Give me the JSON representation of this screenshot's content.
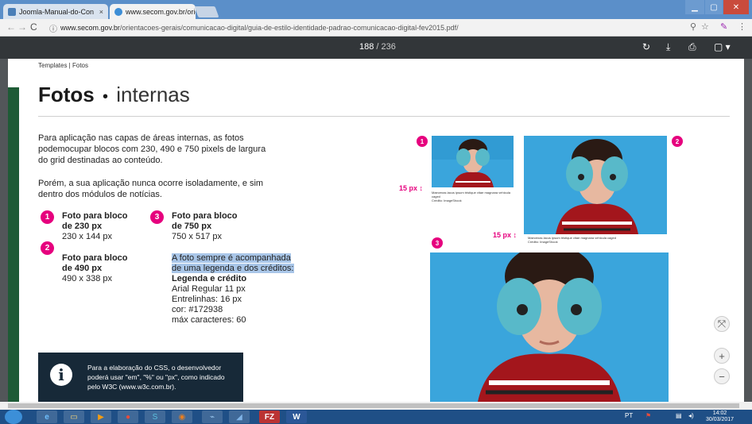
{
  "browser": {
    "tabs": [
      {
        "title": "Joomla-Manual-do-Con",
        "active": false
      },
      {
        "title": "www.secom.gov.br/orien",
        "active": true
      }
    ],
    "close_glyph": "×",
    "url_host": "www.secom.gov.br",
    "url_path": "/orientacoes-gerais/comunicacao-digital/guia-de-estilo-identidade-padrao-comunicacao-digital-fev2015.pdf/",
    "window_controls": [
      "minimize-icon",
      "maximize-icon",
      "close-icon"
    ]
  },
  "pdf_toolbar": {
    "page_current": "188",
    "page_total": "/ 236",
    "icons": [
      "rotate-icon",
      "download-icon",
      "print-icon",
      "bookmark-icon"
    ]
  },
  "document": {
    "breadcrumb": "Templates | Fotos",
    "heading_bold": "Fotos",
    "heading_sep": "•",
    "heading_light": "internas",
    "para1": "Para aplicação nas capas de áreas internas, as fotos podemocupar blocos com 230, 490 e 750 pixels de largura do grid destinadas ao conteúdo.",
    "para2": "Porém, a sua aplicação nunca ocorre isoladamente, e sim dentro dos módulos de notícias.",
    "specs": [
      {
        "num": "1",
        "title_line1": "Foto para bloco",
        "title_line2": "de 230 px",
        "size": "230 x 144 px"
      },
      {
        "num": "2",
        "title_line1": "Foto para bloco",
        "title_line2": "de 490 px",
        "size": "490 x 338 px"
      },
      {
        "num": "3",
        "title_line1": "Foto para bloco",
        "title_line2": "de 750 px",
        "size": "750 x 517 px"
      }
    ],
    "caption_note": {
      "line1": "A foto sempre é  acompanhada",
      "line2": "de uma legenda e dos créditos:",
      "title": "Legenda e crédito",
      "font": "Arial Regular 11 px",
      "leading": "Entrelinhas: 16 px",
      "color": "cor: #172938",
      "max": "máx caracteres: 60"
    },
    "info_box": {
      "icon": "info-icon",
      "glyph": "i",
      "text": "Para a elaboração do CSS, o desenvolvedor poderá usar \"em\", \"%\" ou \"px\", como indicado pelo W3C (www.w3c.com.br)."
    },
    "figures": {
      "gap_label": "15 px",
      "caption_text": "Maecenas lacus ipsum tristique vitae magnana vehicula caged",
      "credit_text": "Crédito: ImageShook",
      "badges": [
        "1",
        "2",
        "3"
      ]
    }
  },
  "colors": {
    "accent": "#e6007e",
    "navy": "#172938",
    "green": "#1e5b36",
    "pdf_toolbar": "#323639"
  },
  "taskbar": {
    "apps": [
      "ie-icon",
      "folder-icon",
      "media-icon",
      "chrome-icon",
      "skype-icon",
      "firefox-icon",
      "network-icon",
      "app-icon",
      "filezilla-icon",
      "word-icon"
    ],
    "app_glyphs": [
      "e",
      "▭",
      "▶",
      "●",
      "S",
      "◉",
      "⌁",
      "◢",
      "FZ",
      "W"
    ],
    "lang": "PT",
    "clock_time": "14:02",
    "clock_date": "30/03/2017"
  }
}
